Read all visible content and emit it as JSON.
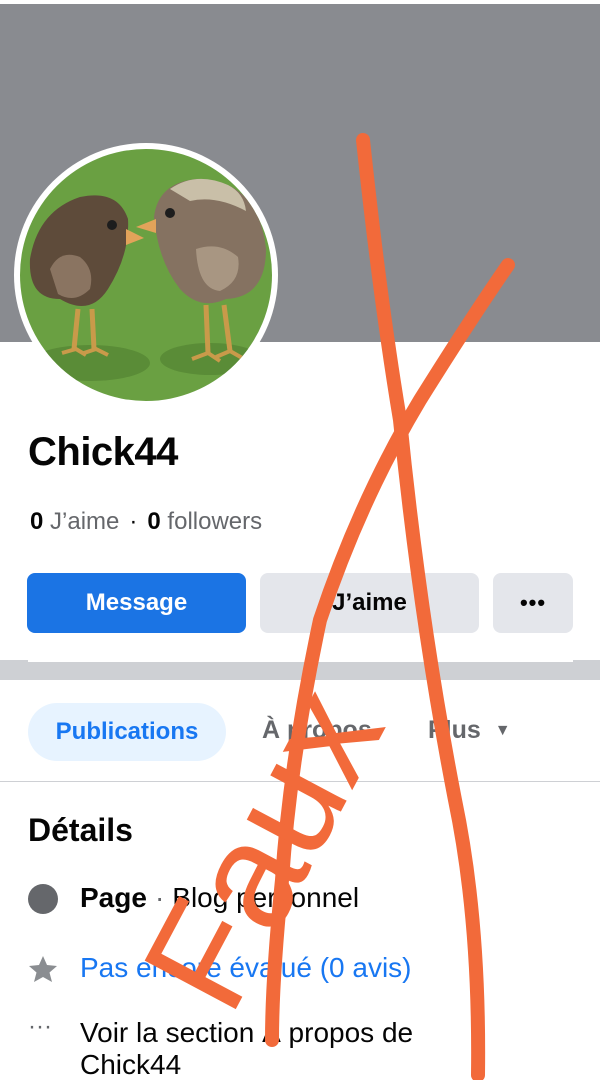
{
  "profile": {
    "name": "Chick44",
    "likes_count": "0",
    "likes_label": "J’aime",
    "followers_count": "0",
    "followers_label": "followers",
    "separator": "·"
  },
  "actions": {
    "message_label": "Message",
    "like_label": "J’aime",
    "more_label": "•••"
  },
  "tabs": {
    "publications": "Publications",
    "about": "À propos",
    "more": "Plus"
  },
  "details": {
    "title": "Détails",
    "category_prefix": "Page",
    "category_separator": "·",
    "category": "Blog personnel",
    "rating": "Pas encore évalué (0 avis)",
    "about_link_line1": "Voir la section À propos de",
    "about_link_line2": "Chick44"
  },
  "icons": {
    "more": "more-dots-icon",
    "caret": "caret-down-icon",
    "page": "page-flag-icon",
    "rating": "star-icon",
    "info": "ellipsis-icon"
  },
  "overlay": {
    "stamp_text": "Faux",
    "stamp_color": "#f26a3a"
  },
  "colors": {
    "primary_blue": "#1b74e4",
    "cover_gray": "#898b90",
    "secondary_button": "#e4e6eb",
    "tab_active_bg": "#e7f3ff"
  }
}
